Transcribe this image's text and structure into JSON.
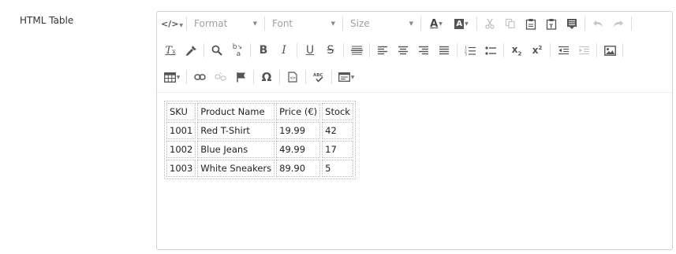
{
  "field": {
    "label": "HTML Table"
  },
  "toolbar": {
    "format_label": "Format",
    "font_label": "Font",
    "size_label": "Size"
  },
  "table": {
    "headers": [
      "SKU",
      "Product Name",
      "Price (€)",
      "Stock"
    ],
    "rows": [
      [
        "1001",
        "Red T-Shirt",
        "19.99",
        "42"
      ],
      [
        "1002",
        "Blue Jeans",
        "49.99",
        "17"
      ],
      [
        "1003",
        "White Sneakers",
        "89.90",
        "5"
      ]
    ]
  },
  "colors": {
    "icon": "#555555",
    "icon_disabled": "#c5c5c5",
    "border": "#d1d1d1"
  }
}
